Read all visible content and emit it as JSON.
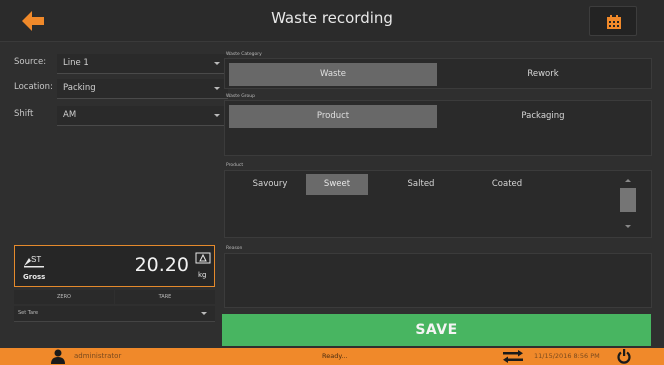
{
  "header": {
    "title": "Waste recording"
  },
  "left_panel": {
    "fields": [
      {
        "label": "Source:",
        "value": "Line 1"
      },
      {
        "label": "Location:",
        "value": "Packing"
      },
      {
        "label": "Shift",
        "value": "AM"
      }
    ]
  },
  "scale": {
    "mode_label": "Gross",
    "weight": "20.20",
    "unit": "kg",
    "zero_label": "ZERO",
    "tare_label": "TARE",
    "set_tare_label": "Set Tare"
  },
  "waste_category": {
    "label": "Waste Category",
    "options": [
      "Waste",
      "Rework"
    ],
    "selected": "Waste"
  },
  "waste_group": {
    "label": "Waste Group",
    "options": [
      "Product",
      "Packaging"
    ],
    "selected": "Product"
  },
  "product": {
    "label": "Product",
    "options": [
      "Savoury",
      "Sweet",
      "Salted",
      "Coated"
    ],
    "selected": "Sweet"
  },
  "reason": {
    "label": "Reason"
  },
  "save_label": "SAVE",
  "statusbar": {
    "user": "administrator",
    "status": "Ready...",
    "datetime": "11/15/2016 8:56 PM"
  },
  "colors": {
    "accent_orange": "#f0892a",
    "save_green": "#48b561",
    "background": "#2f2f2f"
  }
}
